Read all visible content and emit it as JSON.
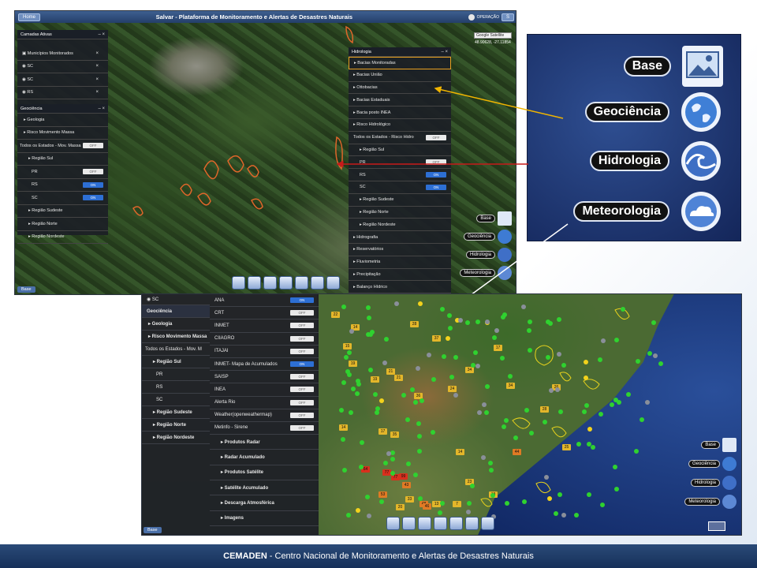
{
  "footer": {
    "brand": "CEMADEN",
    "text": "- Centro Nacional de Monitoramento e Alertas de Desastres Naturais"
  },
  "shot1": {
    "home_button": "Home",
    "title": "Salvar - Plataforma de Monitoramento e Alertas de Desastres Naturais",
    "user": "OPERAÇÃO",
    "logout_short": "S",
    "map_type": "Google Satellite",
    "coords": "48.90628, -27.11854",
    "base_button": "Base",
    "camadas": {
      "title": "Camadas Ativas",
      "items": [
        "Municípios Monitorados",
        "SC",
        "SC",
        "RS"
      ]
    },
    "geociencia": {
      "title": "Geociência",
      "rows": [
        {
          "label": "Geologia",
          "toggle": ""
        },
        {
          "label": "Risco Movimento Massa",
          "toggle": ""
        },
        {
          "label": "Todos os Estados - Mov. Massa",
          "toggle": "OFF"
        },
        {
          "label": "Região Sul",
          "toggle": ""
        },
        {
          "label": "PR",
          "toggle": "OFF"
        },
        {
          "label": "RS",
          "toggle": "ON"
        },
        {
          "label": "SC",
          "toggle": "ON"
        },
        {
          "label": "Região Sudeste",
          "toggle": ""
        },
        {
          "label": "Região Norte",
          "toggle": ""
        },
        {
          "label": "Região Nordeste",
          "toggle": ""
        }
      ]
    },
    "hidrologia": {
      "title": "Hidrologia",
      "rows": [
        {
          "label": "Bacias Monitoradas",
          "toggle": ""
        },
        {
          "label": "Bacias União",
          "toggle": ""
        },
        {
          "label": "Ottobacias",
          "toggle": ""
        },
        {
          "label": "Bacias Estaduais",
          "toggle": ""
        },
        {
          "label": "Bacia posto INEA",
          "toggle": ""
        },
        {
          "label": "Risco Hidrológico",
          "toggle": ""
        },
        {
          "label": "Todos os Estados - Risco Hidro",
          "toggle": "OFF"
        },
        {
          "label": "Região Sul",
          "toggle": ""
        },
        {
          "label": "PR",
          "toggle": "OFF"
        },
        {
          "label": "RS",
          "toggle": "ON"
        },
        {
          "label": "SC",
          "toggle": "ON"
        },
        {
          "label": "Região Sudeste",
          "toggle": ""
        },
        {
          "label": "Região Norte",
          "toggle": ""
        },
        {
          "label": "Região Nordeste",
          "toggle": ""
        },
        {
          "label": "Hidrografia",
          "toggle": ""
        },
        {
          "label": "Reservatórios",
          "toggle": ""
        },
        {
          "label": "Fluviometria",
          "toggle": ""
        },
        {
          "label": "Precipitação",
          "toggle": ""
        },
        {
          "label": "Balanço Hídrico",
          "toggle": ""
        }
      ]
    },
    "legend_small": [
      "Base",
      "Geociência",
      "Hidrologia",
      "Meteorologia"
    ]
  },
  "legend_zoom": [
    "Base",
    "Geociência",
    "Hidrologia",
    "Meteorologia"
  ],
  "shot2": {
    "sc_label": "SC",
    "base_button": "Base",
    "left_rows": [
      {
        "label": "Geociência",
        "kind": "head"
      },
      {
        "label": "Geologia",
        "kind": "bold"
      },
      {
        "label": "Risco Movimento Massa",
        "kind": "bold"
      },
      {
        "label": "Todos os Estados - Mov. M",
        "kind": "plain"
      },
      {
        "label": "Região Sul",
        "kind": "bold"
      },
      {
        "label": "PR",
        "kind": "plain"
      },
      {
        "label": "RS",
        "kind": "plain"
      },
      {
        "label": "SC",
        "kind": "plain"
      },
      {
        "label": "Região Sudeste",
        "kind": "bold"
      },
      {
        "label": "Região Norte",
        "kind": "bold"
      },
      {
        "label": "Região Nordeste",
        "kind": "bold"
      }
    ],
    "meteo_rows": [
      {
        "label": "ANA",
        "toggle": "ON"
      },
      {
        "label": "CRT",
        "toggle": "OFF"
      },
      {
        "label": "INMET",
        "toggle": "OFF"
      },
      {
        "label": "CIIAGRO",
        "toggle": "OFF"
      },
      {
        "label": "ITAJAI",
        "toggle": "OFF"
      },
      {
        "label": "INMET- Mapa de Acumulados",
        "toggle": "ON"
      },
      {
        "label": "SAISP",
        "toggle": "OFF"
      },
      {
        "label": "INEA",
        "toggle": "OFF"
      },
      {
        "label": "Alerta Rio",
        "toggle": "OFF"
      },
      {
        "label": "Weather(openweathermap)",
        "toggle": "OFF"
      },
      {
        "label": "Metinfo - Sirene",
        "toggle": "OFF"
      }
    ],
    "meteo_groups": [
      "Produtos Radar",
      "Radar Acumulado",
      "Produtos Satélite",
      "Satélite Acumulado",
      "Descarga Atmosférica",
      "Imagens"
    ],
    "legend_small": [
      "Base",
      "Geociência",
      "Hidrologia",
      "Meteorologia"
    ],
    "markers": [
      "22",
      "14",
      "15",
      "19",
      "28",
      "37",
      "21",
      "19",
      "17",
      "21",
      "24",
      "36",
      "14",
      "17",
      "35",
      "34",
      "26",
      "28",
      "25",
      "44",
      "64",
      "77",
      "77",
      "99",
      "43",
      "53",
      "33",
      "20",
      "48",
      "13",
      "46",
      "14",
      "34",
      "23",
      "18",
      "7"
    ]
  },
  "colors": {
    "accent": "#2d6fd4",
    "header": "#243f6a",
    "panel": "#1c2026"
  }
}
